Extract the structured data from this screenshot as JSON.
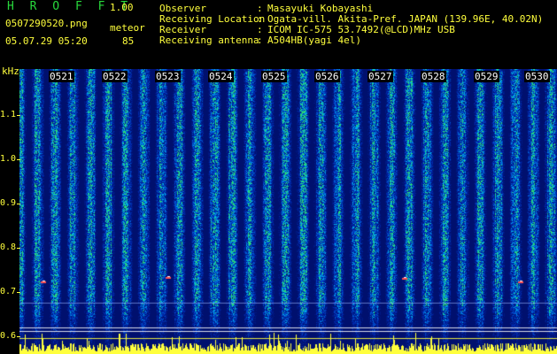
{
  "header": {
    "app_name": "H R O F F T",
    "version": "1.00",
    "filename": "0507290520.png",
    "mode": "meteor",
    "datetime": "05.07.29 05:20",
    "count": "85"
  },
  "info": {
    "observer_label": "Observer",
    "observer": "Masayuki Kobayashi",
    "location_label": "Receiving Location",
    "location": "Ogata-vill. Akita-Pref. JAPAN (139.96E, 40.02N)",
    "receiver_label": "Receiver",
    "receiver": "ICOM IC-575 53.7492(@LCD)MHz USB",
    "antenna_label": "Receiving antenna",
    "antenna": "A504HB(yagi 4el)",
    "separator": ":"
  },
  "axis": {
    "unit": "kHz",
    "y_ticks": [
      "1.1",
      "1.0",
      "0.9",
      "0.8",
      "0.7",
      "0.6"
    ],
    "time_labels": [
      "0521",
      "0522",
      "0523",
      "0524",
      "0525",
      "0526",
      "0527",
      "0528",
      "0529",
      "0530"
    ]
  },
  "colors": {
    "yellow": "#ffff3c",
    "green": "#28d83c",
    "bg_blue": "#00106e"
  }
}
